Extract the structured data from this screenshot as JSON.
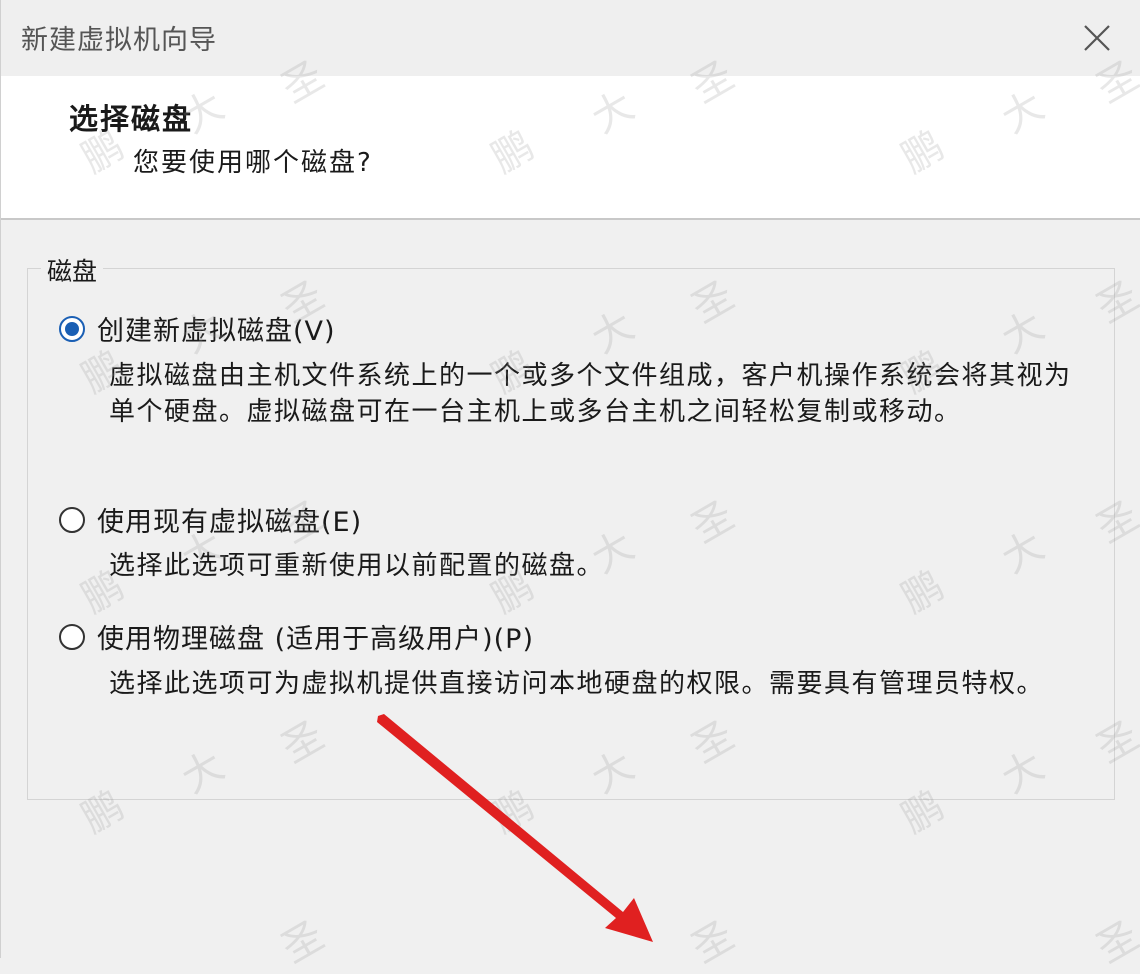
{
  "window": {
    "title": "新建虚拟机向导",
    "close_icon": "close-icon"
  },
  "header": {
    "title": "选择磁盘",
    "subtitle": "您要使用哪个磁盘?"
  },
  "disk_group": {
    "label": "磁盘",
    "options": [
      {
        "label": "创建新虚拟磁盘(V)",
        "checked": true,
        "description": "虚拟磁盘由主机文件系统上的一个或多个文件组成，客户机操作系统会将其视为单个硬盘。虚拟磁盘可在一台主机上或多台主机之间轻松复制或移动。"
      },
      {
        "label": "使用现有虚拟磁盘(E)",
        "checked": false,
        "description": "选择此选项可重新使用以前配置的磁盘。"
      },
      {
        "label": "使用物理磁盘 (适用于高级用户)(P)",
        "checked": false,
        "description": "选择此选项可为虚拟机提供直接访问本地硬盘的权限。需要具有管理员特权。"
      }
    ]
  },
  "watermark": {
    "chars": [
      "鹏",
      "大",
      "圣"
    ]
  },
  "colors": {
    "accent": "#1a5fb4",
    "arrow": "#e02020"
  }
}
